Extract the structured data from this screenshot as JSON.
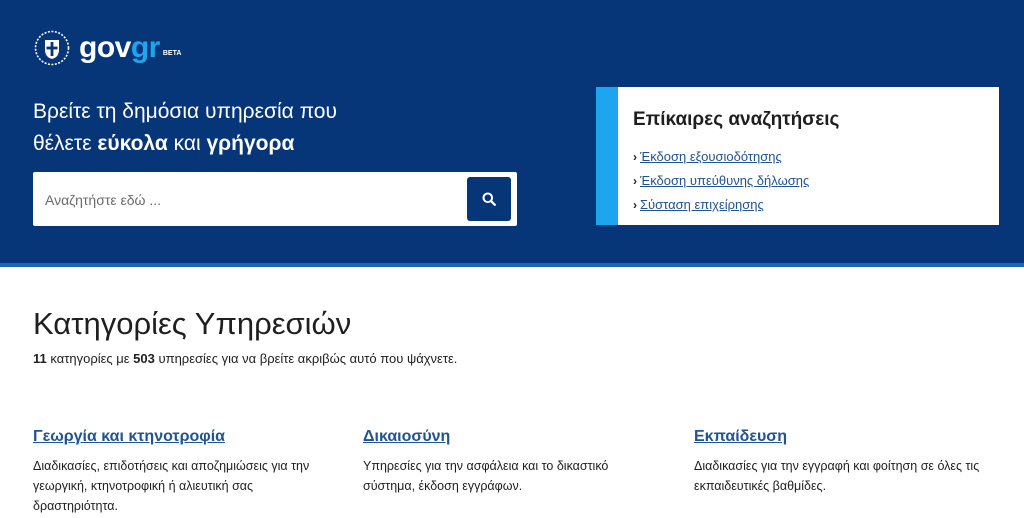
{
  "header": {
    "logo": {
      "gov": "gov",
      "gr": "gr",
      "beta": "BETA",
      "emblem_icon": "greek-coat-of-arms"
    },
    "title_line1": "Βρείτε τη δημόσια υπηρεσία που",
    "title_line2_a": "θέλετε ",
    "title_line2_b": "εύκολα",
    "title_line2_c": " και ",
    "title_line2_d": "γρήγορα"
  },
  "search": {
    "placeholder": "Αναζητήστε εδώ ...",
    "value": "",
    "button_icon": "search-icon"
  },
  "trending": {
    "title": "Επίκαιρες αναζητήσεις",
    "items": [
      {
        "label": "Έκδοση εξουσιοδότησης"
      },
      {
        "label": "Έκδοση υπεύθυνης δήλωσης"
      },
      {
        "label": "Σύσταση επιχείρησης"
      }
    ]
  },
  "categories_section": {
    "title": "Κατηγορίες Υπηρεσιών",
    "count_categories": "11",
    "text_a": " κατηγορίες με ",
    "count_services": "503",
    "text_b": " υπηρεσίες για να βρείτε ακριβώς αυτό που ψάχνετε.",
    "items": [
      {
        "title": "Γεωργία και κτηνοτροφία",
        "description": "Διαδικασίες, επιδοτήσεις και αποζημιώσεις για την γεωργική, κτηνοτροφική ή αλιευτική σας δραστηριότητα."
      },
      {
        "title": "Δικαιοσύνη",
        "description": "Υπηρεσίες για την ασφάλεια και το δικαστικό σύστημα, έκδοση εγγράφων."
      },
      {
        "title": "Εκπαίδευση",
        "description": "Διαδικασίες για την εγγραφή και φοίτηση σε όλες τις εκπαιδευτικές βαθμίδες."
      }
    ]
  },
  "colors": {
    "hero_bg": "#063578",
    "accent": "#1ea5f0",
    "link": "#205493"
  }
}
